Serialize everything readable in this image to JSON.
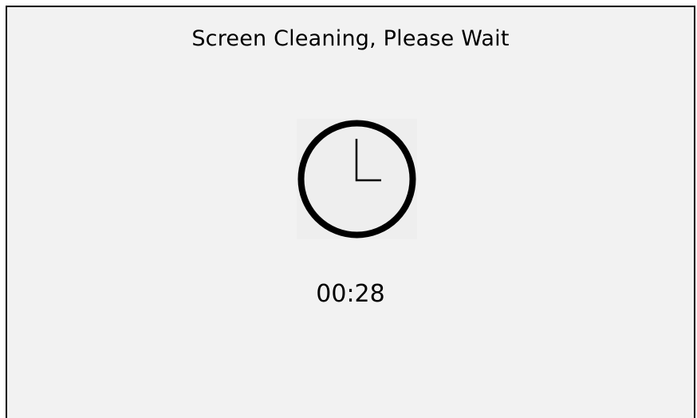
{
  "dialog": {
    "title": "Screen Cleaning, Please Wait",
    "icon": "clock-icon",
    "countdown": "00:28"
  },
  "colors": {
    "background": "#f2f2f2",
    "border": "#000000",
    "text": "#000000"
  }
}
